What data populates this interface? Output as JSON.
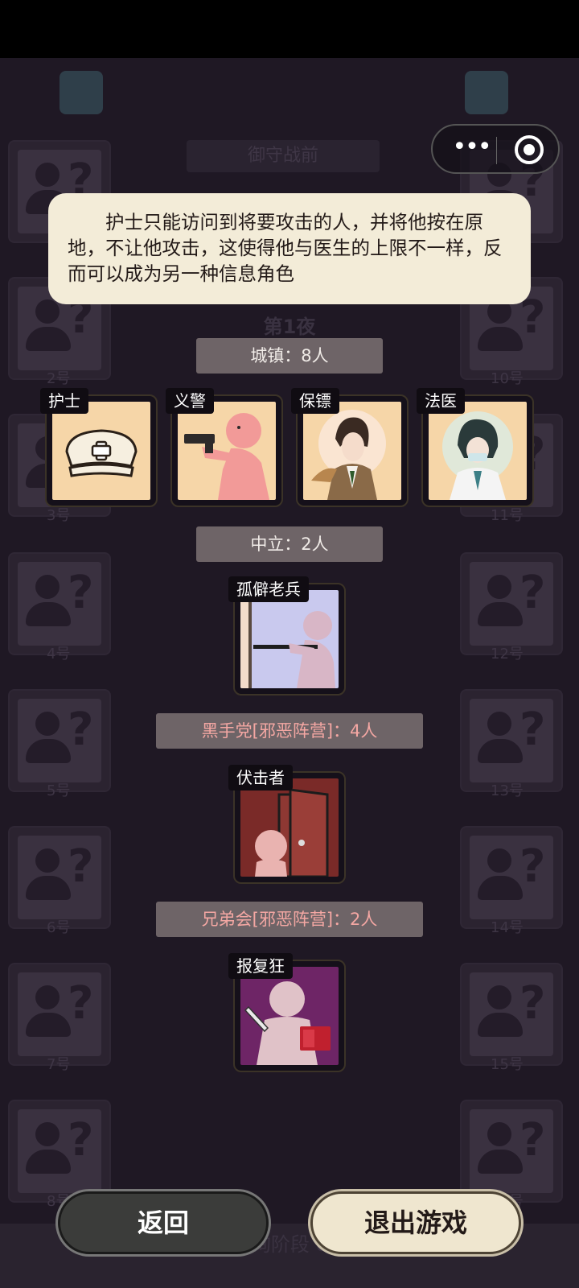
{
  "background": {
    "title": "御守战前",
    "night_label": "第1夜",
    "phase_text": "问询阶段 0/6",
    "left_seat_labels": [
      "2号",
      "3号",
      "4号",
      "5号",
      "6号",
      "7号",
      "8号"
    ],
    "right_seat_labels": [
      "10号",
      "11号",
      "12号",
      "13号",
      "14号",
      "15号",
      "16号"
    ]
  },
  "capsule": {
    "more_icon": "more-dots-icon",
    "close_icon": "target-circle-icon"
  },
  "tooltip": {
    "text": "护士只能访问到将要攻击的人，并将他按在原地，不让他攻击，这使得他与医生的上限不一样，反而可以成为另一种信息角色"
  },
  "groups": [
    {
      "header": "城镇：8人",
      "header_color": "#f1ece8",
      "roles": [
        {
          "name": "护士",
          "icon": "nurse-cap-icon",
          "bg": "#f6d6a8"
        },
        {
          "name": "义警",
          "icon": "gunman-icon",
          "bg": "#f6d6a8"
        },
        {
          "name": "保镖",
          "icon": "bodyguard-portrait-icon",
          "bg": "#f6d6a8"
        },
        {
          "name": "法医",
          "icon": "coroner-portrait-icon",
          "bg": "#f6d6a8"
        }
      ]
    },
    {
      "header": "中立：2人",
      "header_color": "#f1ece8",
      "roles": [
        {
          "name": "孤僻老兵",
          "icon": "veteran-icon",
          "bg": "#c9c9ee"
        }
      ]
    },
    {
      "header": "黑手党[邪恶阵营]：4人",
      "header_color": "#f4a7a3",
      "roles": [
        {
          "name": "伏击者",
          "icon": "ambusher-icon",
          "bg": "#7a2a28"
        }
      ]
    },
    {
      "header": "兄弟会[邪恶阵营]：2人",
      "header_color": "#f4a7a3",
      "roles": [
        {
          "name": "报复狂",
          "icon": "avenger-icon",
          "bg": "#6e2566"
        }
      ]
    }
  ],
  "buttons": {
    "back": "返回",
    "exit": "退出游戏"
  }
}
